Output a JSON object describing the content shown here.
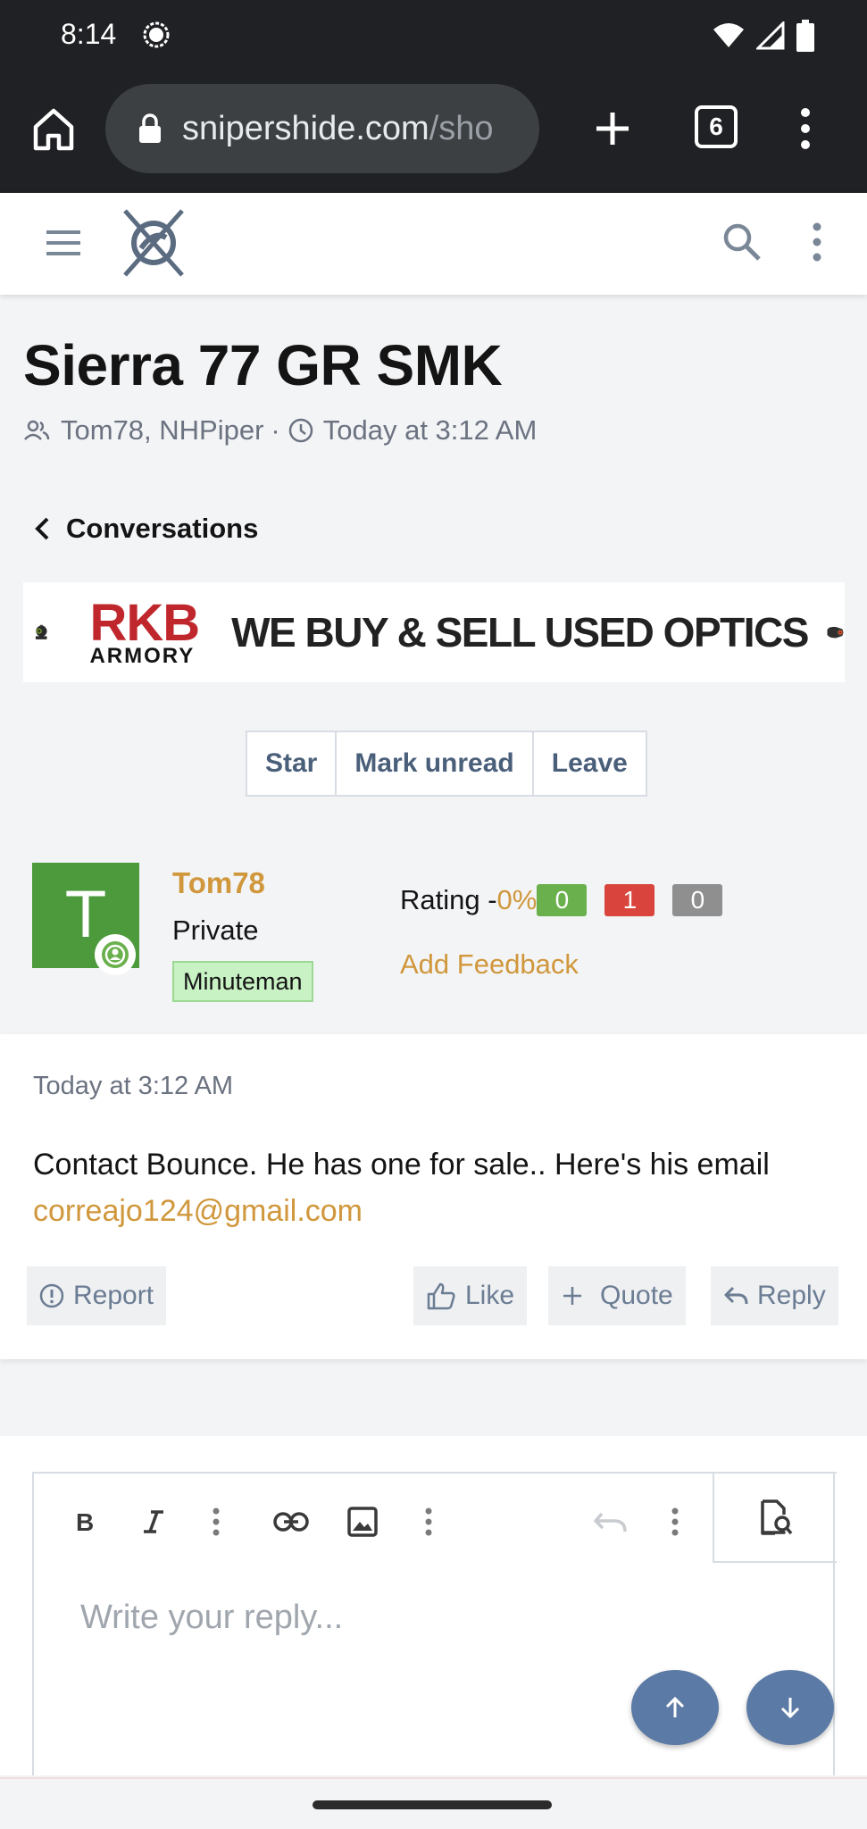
{
  "status_bar": {
    "time": "8:14"
  },
  "browser": {
    "url_main": "snipershide.com",
    "url_rest": "/sho",
    "tab_count": "6"
  },
  "thread": {
    "title": "Sierra 77 GR SMK",
    "participants": "Tom78, NHPiper",
    "separator": "·",
    "date": "Today at 3:12 AM",
    "back_label": "Conversations"
  },
  "banner": {
    "brand_top": "RKB",
    "brand_bottom": "ARMORY",
    "slogan": "WE BUY & SELL USED OPTICS"
  },
  "actions": {
    "star": "Star",
    "mark_unread": "Mark unread",
    "leave": "Leave"
  },
  "message": {
    "avatar_letter": "T",
    "username": "Tom78",
    "user_title": "Private",
    "user_badge": "Minuteman",
    "rating_label": "Rating -",
    "rating_percent": "0%",
    "feedback_positive": "0",
    "feedback_negative": "1",
    "feedback_neutral": "0",
    "add_feedback": "Add Feedback",
    "date": "Today at 3:12 AM",
    "text": "Contact Bounce. He has one for sale.. Here's his email",
    "email": "correajo124@gmail.com",
    "report": "Report",
    "like": "Like",
    "quote": "Quote",
    "reply": "Reply"
  },
  "reply_editor": {
    "placeholder": "Write your reply..."
  },
  "colors": {
    "accent": "#d0973c",
    "positive": "#6ab04c",
    "negative": "#d9453d",
    "neutral": "#8f8f8f",
    "fab": "#5b7aa5"
  }
}
